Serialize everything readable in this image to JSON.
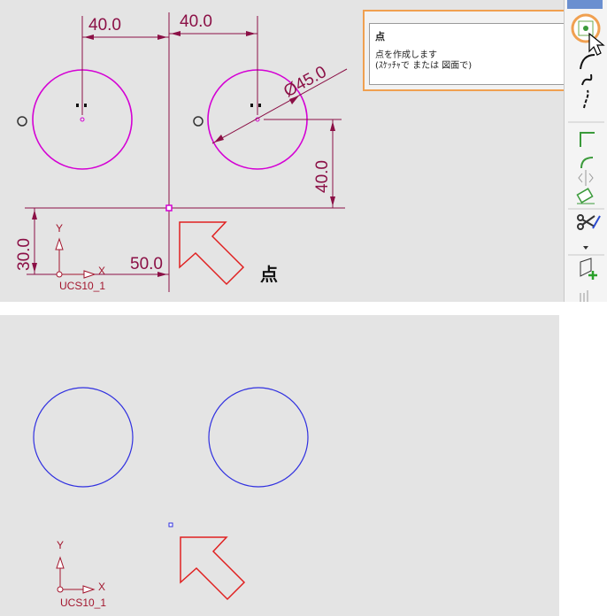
{
  "sketch_top": {
    "dimensions": {
      "width_left": "40.0",
      "width_right": "40.0",
      "diameter": "Ø45.0",
      "height_right": "40.0",
      "height_left": "30.0",
      "x_offset": "50.0"
    },
    "ucs": {
      "y_axis": "Y",
      "x_axis": "X",
      "name": "UCS10_1"
    },
    "colors": {
      "geometry": "#d400d4",
      "dimension": "#8b1046",
      "ucs": "#a3162e",
      "arrow": "#e02020"
    }
  },
  "tooltip": {
    "title": "点",
    "description": "点を作成します",
    "hint": "(ｽｹｯﾁｬで または 図面で)",
    "highlight_color": "#f0a050"
  },
  "caption": "点",
  "toolbar": {
    "icons": [
      "point-icon",
      "arc-icon",
      "spline-icon",
      "centerline-icon",
      "corner-icon",
      "fillet-icon",
      "mirror-icon",
      "erase-icon",
      "trim-icon",
      "dropdown-icon",
      "insert-icon",
      "delete-icon"
    ]
  },
  "sketch_bottom": {
    "ucs": {
      "y_axis": "Y",
      "x_axis": "X",
      "name": "UCS10_1"
    },
    "colors": {
      "geometry": "#3030e0",
      "ucs": "#a3162e",
      "arrow": "#e02020"
    }
  }
}
